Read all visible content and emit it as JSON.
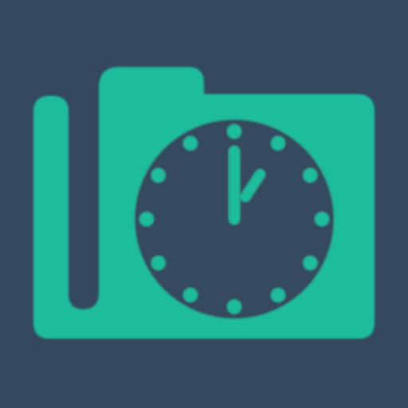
{
  "icon": {
    "name": "folder-clock-icon",
    "description_visible_text": "",
    "colors": {
      "background": "#34495e",
      "folder": "#1abc9c",
      "clock_face": "#34495e",
      "clock_marks": "#1abc9c"
    },
    "clock": {
      "hour_marks": 12,
      "hour": 1,
      "minute": 0
    }
  }
}
